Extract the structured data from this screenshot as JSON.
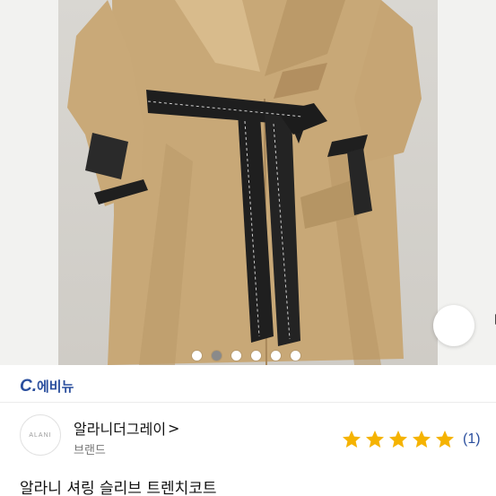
{
  "carousel": {
    "total_slides": 6,
    "active_index": 1
  },
  "share": {
    "icon": "share-icon"
  },
  "store_tag": {
    "prefix": "C.",
    "label": "에비뉴",
    "color": "#2b4f9e"
  },
  "brand": {
    "logo_text": "ALANI",
    "name": "알라니더그레이",
    "chevron": ">",
    "sub_label": "브랜드"
  },
  "rating": {
    "stars": 5,
    "star_color": "#f5b301",
    "count_text": "(1)"
  },
  "product": {
    "title": "알라니 셔링 슬리브 트렌치코트"
  }
}
